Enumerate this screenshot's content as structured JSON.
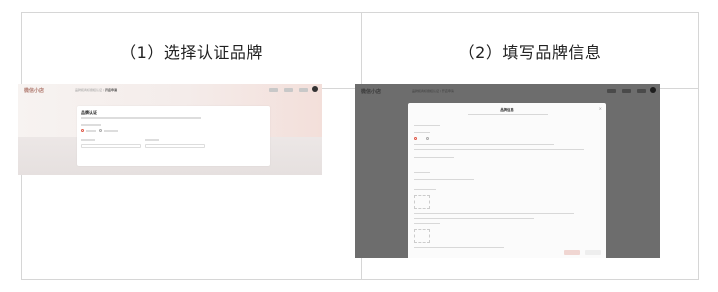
{
  "steps": [
    {
      "title": "（1）选择认证品牌"
    },
    {
      "title": "（2）填写品牌信息"
    }
  ],
  "shot1": {
    "logo": "微信小店",
    "breadcrumb_prefix": "品牌和商标授权认证 /",
    "breadcrumb_current": "开店申请",
    "card_title": "品牌认证"
  },
  "shot2": {
    "logo": "微信小店",
    "breadcrumb": "品牌和商标授权认证 / 开店申请",
    "modal_title": "品牌信息",
    "close": "×"
  },
  "colors": {
    "border": "#d6d6d6",
    "accent": "#e05a4a",
    "overlay": "#6d6d6d"
  }
}
